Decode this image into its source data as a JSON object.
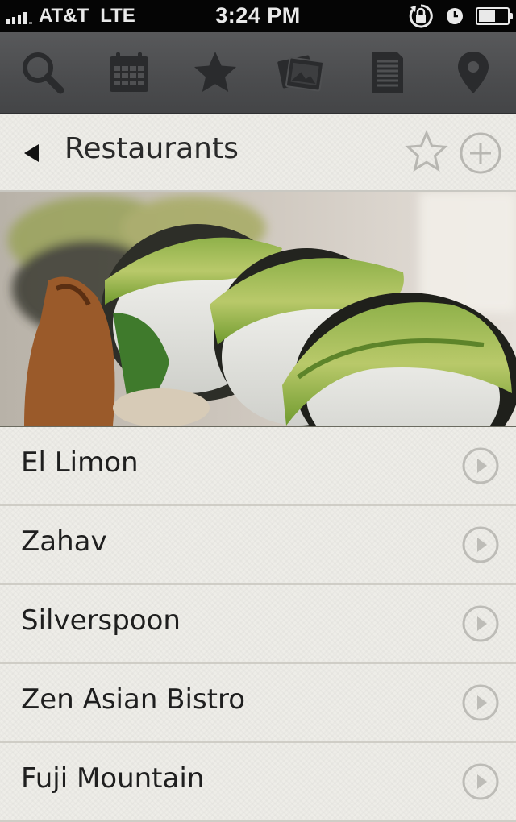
{
  "status_bar": {
    "carrier": "AT&T",
    "network": "LTE",
    "time": "3:24 PM"
  },
  "toolbar": {
    "items": [
      {
        "icon": "search-icon"
      },
      {
        "icon": "calendar-icon"
      },
      {
        "icon": "star-icon"
      },
      {
        "icon": "photos-icon"
      },
      {
        "icon": "document-icon"
      },
      {
        "icon": "map-pin-icon"
      }
    ]
  },
  "navbar": {
    "title": "Restaurants",
    "back_icon": "back-arrow-icon",
    "favorite_icon": "star-outline-icon",
    "add_icon": "plus-circle-icon"
  },
  "hero": {
    "image": "sushi rolls with avocado"
  },
  "restaurants": [
    {
      "name": "El Limon"
    },
    {
      "name": "Zahav"
    },
    {
      "name": "Silverspoon"
    },
    {
      "name": "Zen Asian Bistro"
    },
    {
      "name": "Fuji Mountain"
    }
  ],
  "colors": {
    "toolbar_bg": "#4b4c4e",
    "toolbar_icon": "#2b2c2e",
    "page_bg": "#eeede8",
    "accessory": "#b9b8b3"
  }
}
